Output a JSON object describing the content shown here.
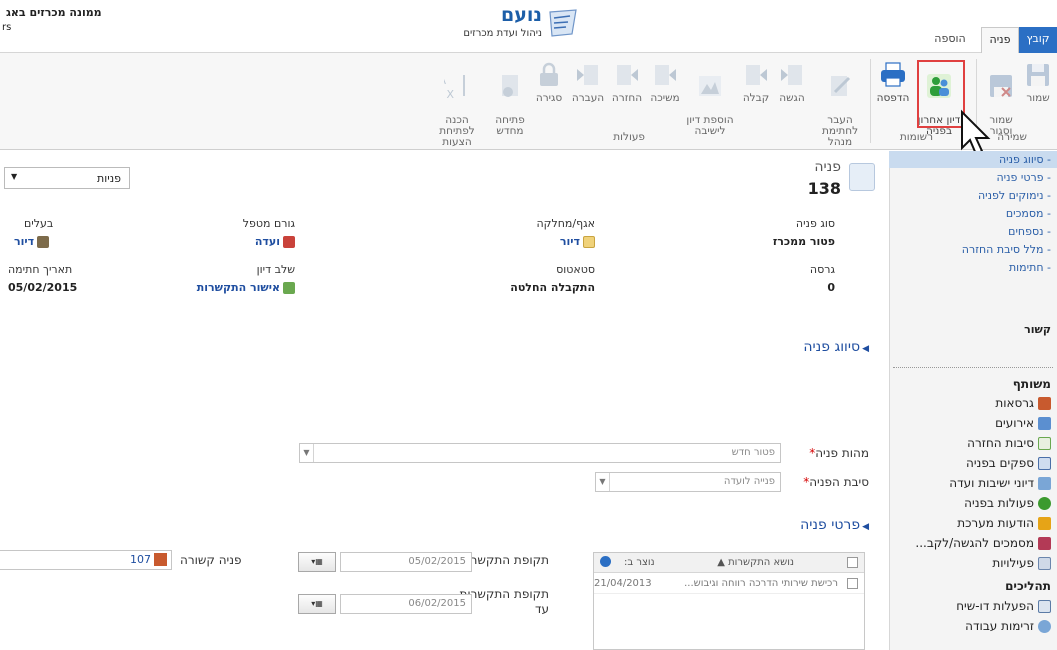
{
  "app": {
    "logo_title": "נועם",
    "logo_subtitle": "ניהול ועדת מכרזים",
    "org_title": "ממונה מכרזים באג",
    "org_sub": "rs"
  },
  "tabs": {
    "file": "קובץ",
    "inquiry": "פניה",
    "add": "הוספה"
  },
  "ribbon": {
    "save_group": {
      "label": "שמירה",
      "save": "שמור",
      "save_close": "שמור\nוסגור"
    },
    "records_group": {
      "label": "רשומות",
      "last_discussion": "דיון אחרון\nבפניה",
      "print": "הדפסה"
    },
    "actions_group": {
      "label": "פעולות",
      "manager_signature": "העבר לחתימת\nמנהל",
      "submit": "הגשה",
      "receive": "קבלה",
      "add_discussion": "הוספת דיון\nלישיבה",
      "withdraw": "משיכה",
      "return": "החזרה",
      "transfer": "העברה",
      "close": "סגירה",
      "reopen": "פתיחה\nמחדש",
      "prepare_bids": "הכנה לפתיחת\nהצעות"
    }
  },
  "nav": {
    "links": [
      "סיווג פניה",
      "פרטי פניה",
      "נימוקים לפניה",
      "מסמכים",
      "נספחים",
      "מלל סיבת החזרה",
      "חתימות"
    ],
    "related_header": "קשור",
    "shared_header": "משותף",
    "shared_items": [
      "גרסאות",
      "אירועים",
      "סיבות החזרה",
      "ספקים בפניה",
      "דיוני ישיבות ועדה",
      "פעולות בפניה",
      "הודעות מערכת",
      "מסמכים להגשה/לקב...",
      "פעילויות"
    ],
    "processes_header": "תהליכים",
    "process_items": [
      "הפעלות דו-שיח",
      "זרימות עבודה"
    ]
  },
  "record": {
    "entity": "פניה",
    "number": "138",
    "view_selector": "פניות",
    "fields": {
      "type_label": "סוג פניה",
      "type_value": "פטור ממכרז",
      "dept_label": "אגף/מחלקה",
      "dept_value": "דיור",
      "handler_label": "גורם מטפל",
      "handler_value": "ועדה",
      "owner_label": "בעלים",
      "owner_value": "דיור",
      "version_label": "גרסה",
      "version_value": "0",
      "status_label": "סטאטוס",
      "status_value": "התקבלה החלטה",
      "stage_label": "שלב דיון",
      "stage_value": "אישור התקשרות",
      "sign_date_label": "תאריך חתימה",
      "sign_date_value": "05/02/2015"
    }
  },
  "section_classification": {
    "title": "סיווג פניה",
    "essence_label": "מהות פניה",
    "essence_value": "פטור חדש",
    "reason_label": "סיבת הפניה",
    "reason_value": "פנייה לועדה"
  },
  "section_details": {
    "title": "פרטי פניה",
    "period_from_label": "תקופת התקשרות מ",
    "period_from_value": "05/02/2015",
    "period_to_label": "תקופת התקשרות\nעד",
    "period_to_value": "06/02/2015",
    "related_label": "פניה קשורה",
    "related_value": "107",
    "grid": {
      "col_subject": "נושא התקשרות ▲",
      "col_created": "נוצר ב:",
      "rows": [
        {
          "subject": "רכישת שירותי הדרכה רווחה וגיבוש...",
          "created": "21/04/2013"
        }
      ]
    }
  }
}
